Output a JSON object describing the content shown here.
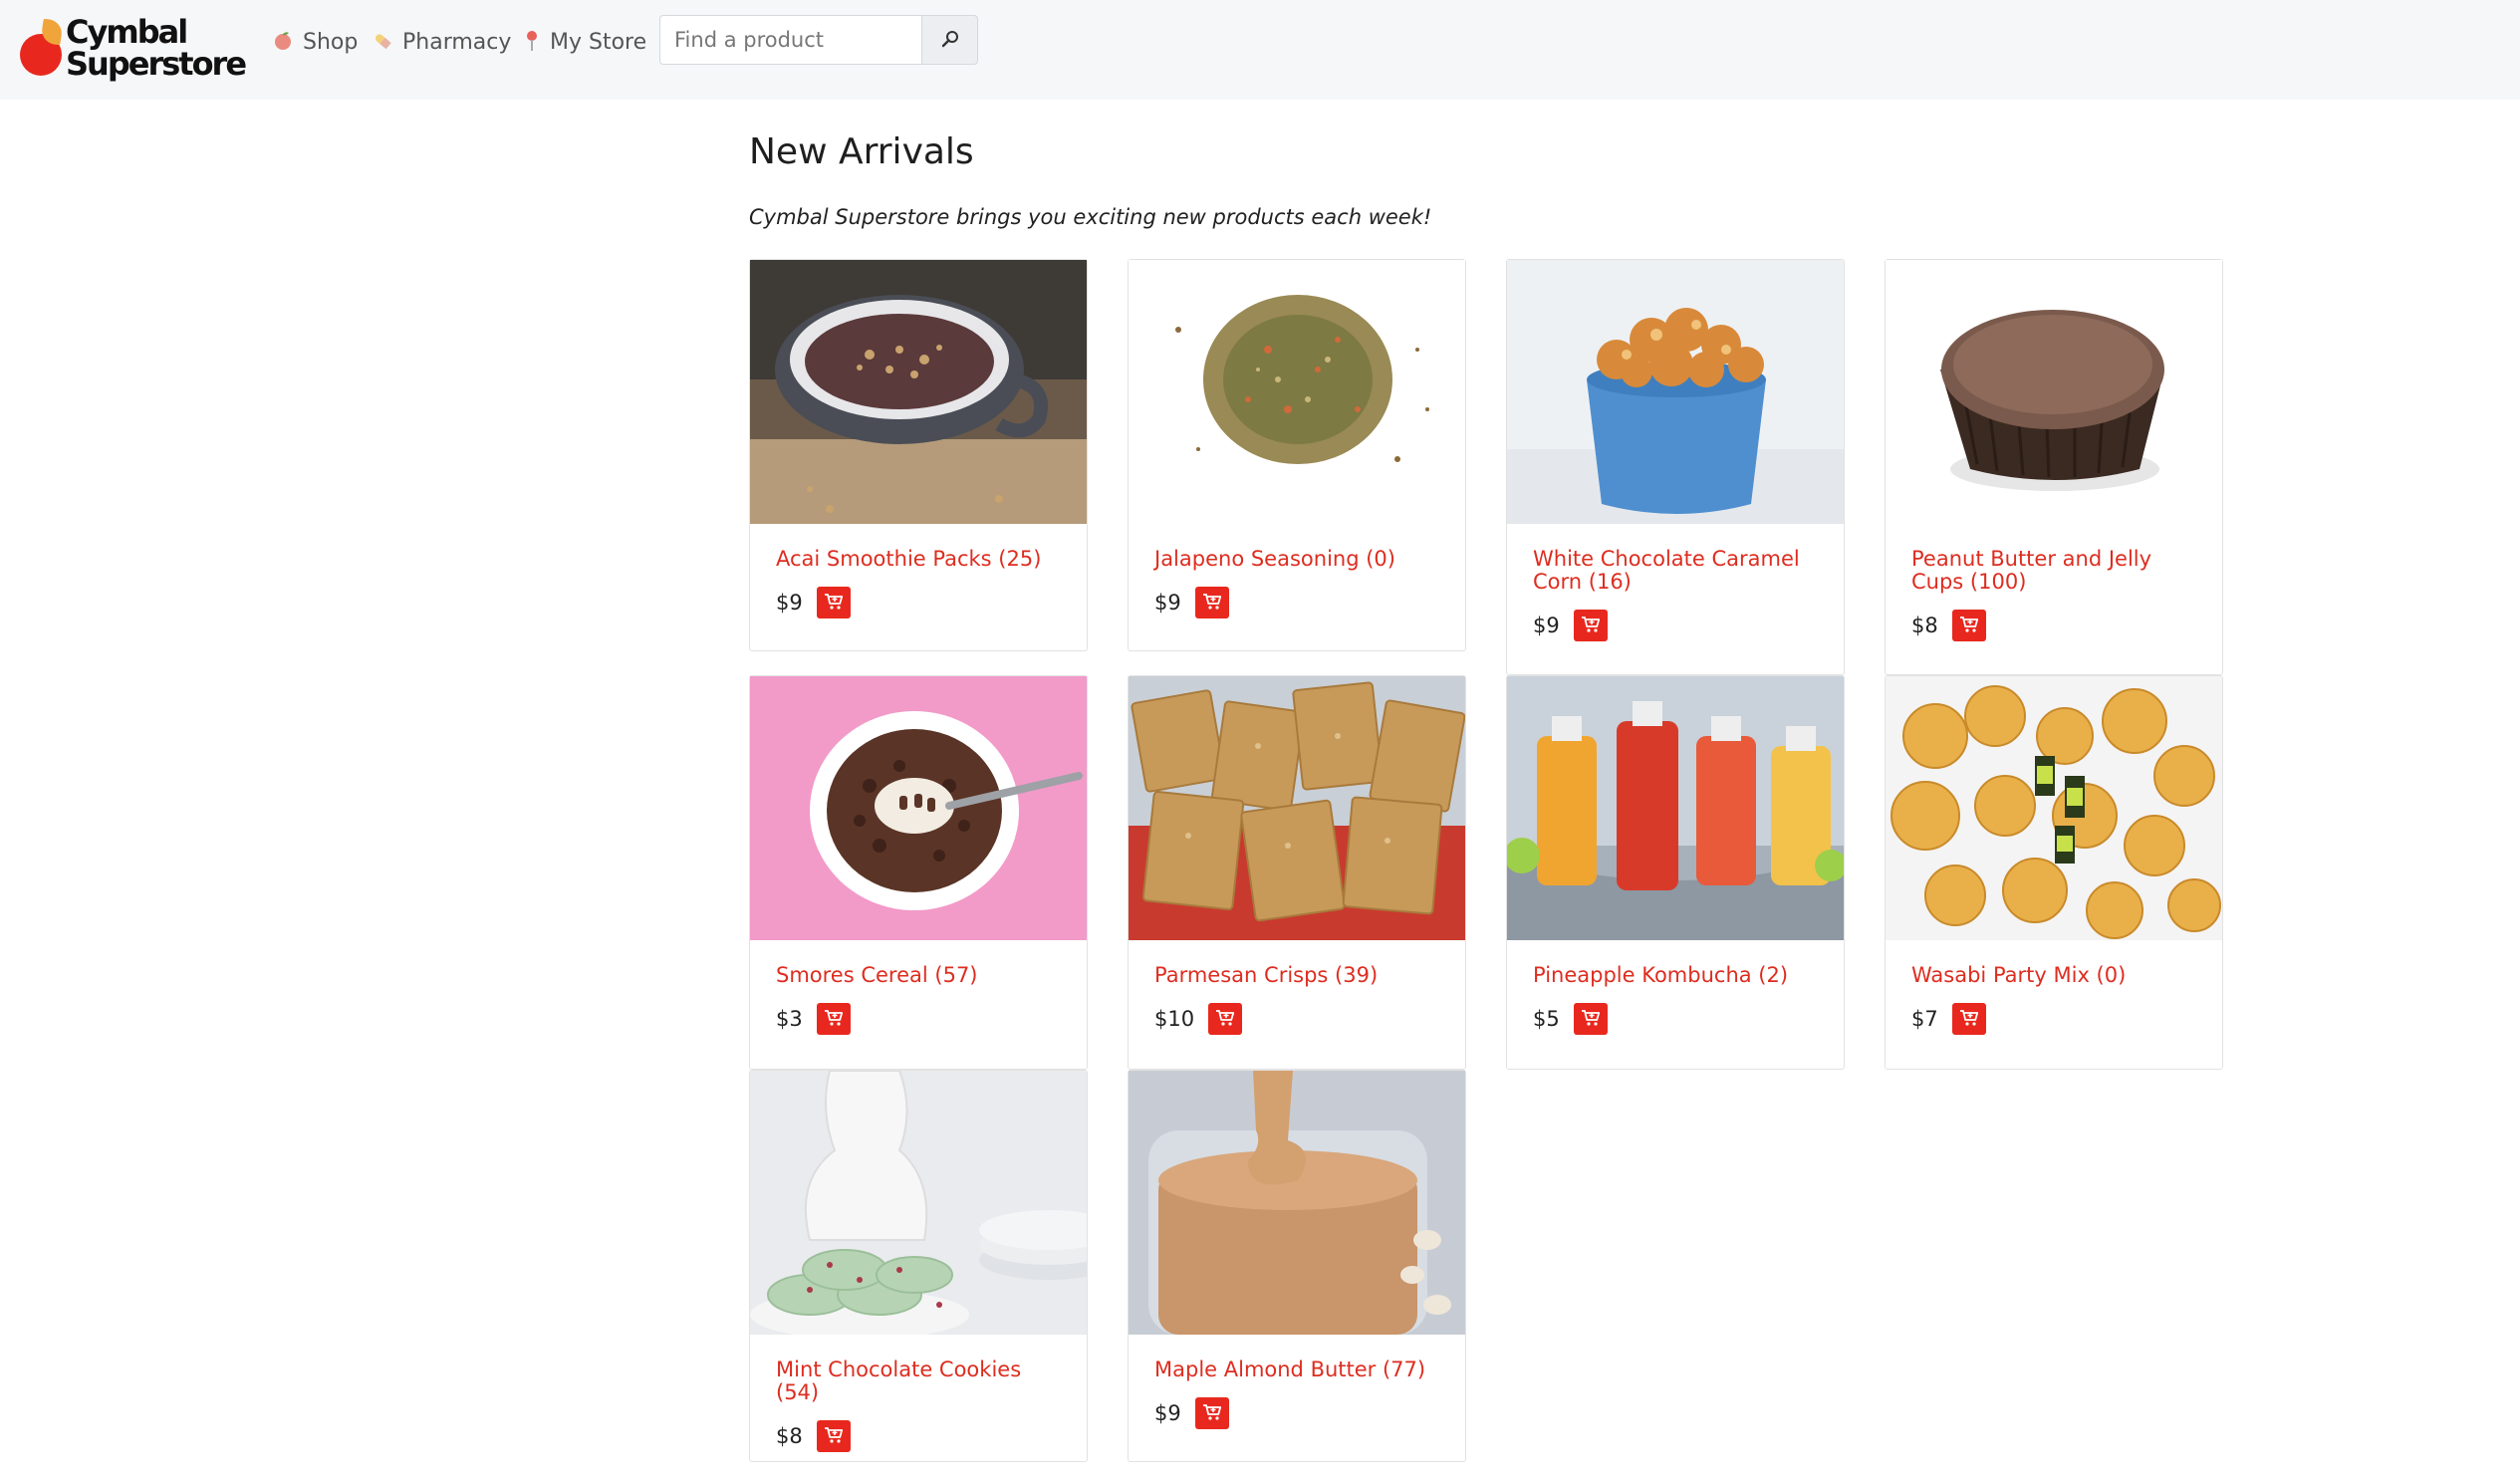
{
  "header": {
    "logo_line1": "Cymbal",
    "logo_line2": "Superstore",
    "nav": {
      "shop": "Shop",
      "pharmacy": "Pharmacy",
      "my_store": "My Store"
    },
    "search": {
      "placeholder": "Find a product",
      "value": ""
    }
  },
  "main": {
    "title": "New Arrivals",
    "tagline": "Cymbal Superstore brings you exciting new products each week!",
    "products": [
      {
        "name": "Acai Smoothie Packs (25)",
        "price": "$9"
      },
      {
        "name": "Jalapeno Seasoning (0)",
        "price": "$9"
      },
      {
        "name": "White Chocolate Caramel Corn (16)",
        "price": "$9"
      },
      {
        "name": "Peanut Butter and Jelly Cups (100)",
        "price": "$8"
      },
      {
        "name": "Smores Cereal (57)",
        "price": "$3"
      },
      {
        "name": "Parmesan Crisps (39)",
        "price": "$10"
      },
      {
        "name": "Pineapple Kombucha (2)",
        "price": "$5"
      },
      {
        "name": "Wasabi Party Mix (0)",
        "price": "$7"
      },
      {
        "name": "Mint Chocolate Cookies (54)",
        "price": "$8"
      },
      {
        "name": "Maple Almond Butter (77)",
        "price": "$9"
      }
    ]
  },
  "colors": {
    "brand_red": "#e8281e",
    "link_red": "#dd2d20",
    "header_bg": "#f6f7f9"
  },
  "icons": {
    "shop": "peach-icon",
    "pharmacy": "pill-icon",
    "store": "map-pin-icon",
    "search": "search-icon",
    "cart": "cart-icon"
  }
}
